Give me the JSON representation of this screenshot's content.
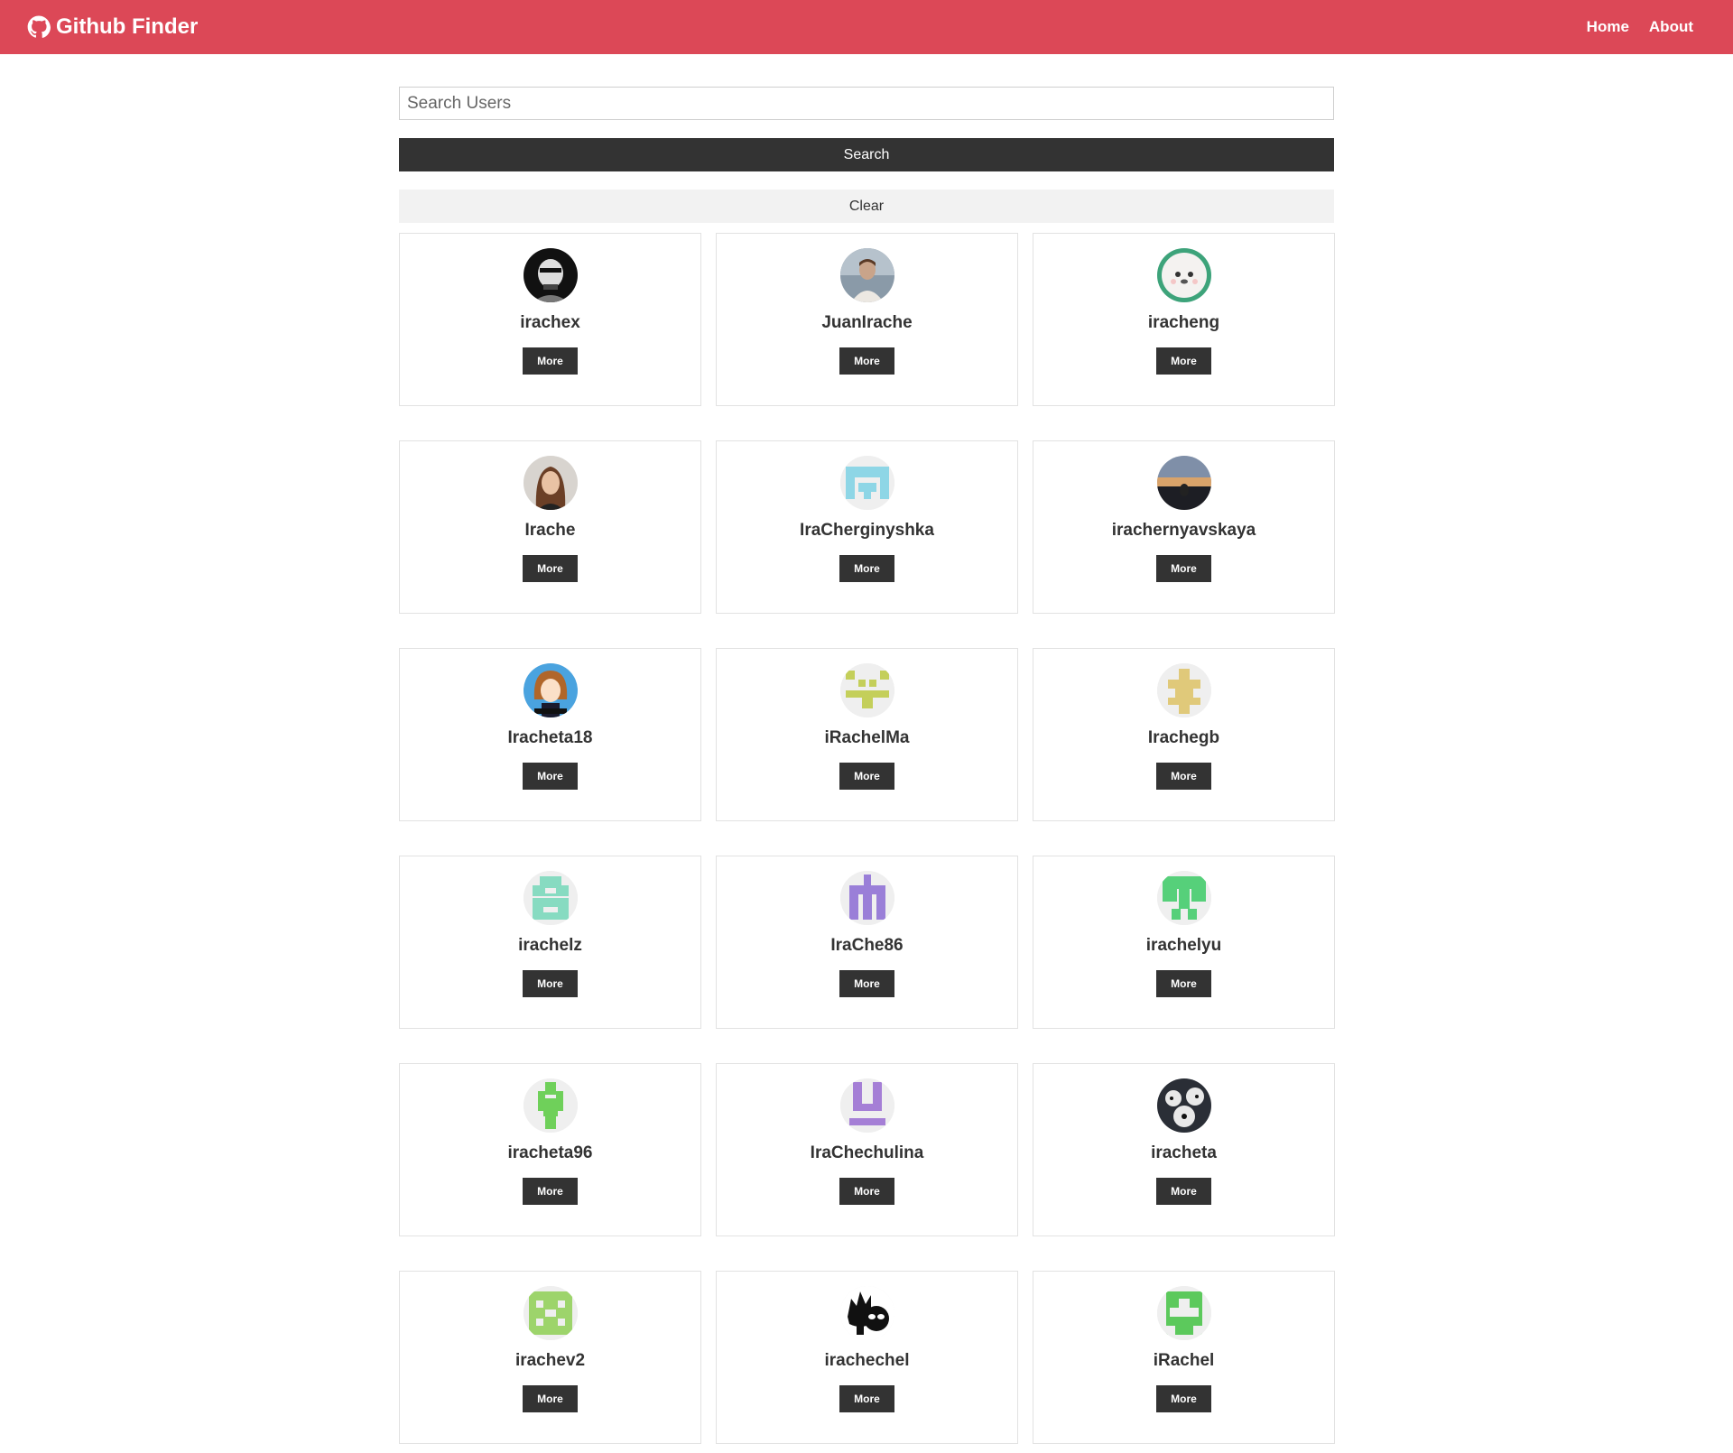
{
  "navbar": {
    "title": "Github Finder",
    "links": [
      {
        "label": "Home"
      },
      {
        "label": "About"
      }
    ]
  },
  "search": {
    "placeholder": "Search Users",
    "value": "",
    "submit_label": "Search",
    "clear_label": "Clear"
  },
  "users": [
    {
      "login": "irachex",
      "button": "More",
      "avatar": "photo-bw"
    },
    {
      "login": "JuanIrache",
      "button": "More",
      "avatar": "photo-man"
    },
    {
      "login": "iracheng",
      "button": "More",
      "avatar": "cartoon-face"
    },
    {
      "login": "Irache",
      "button": "More",
      "avatar": "photo-woman"
    },
    {
      "login": "IraCherginyshka",
      "button": "More",
      "avatar": "identicon-lightblue"
    },
    {
      "login": "irachernyavskaya",
      "button": "More",
      "avatar": "photo-sunset"
    },
    {
      "login": "Iracheta18",
      "button": "More",
      "avatar": "anime"
    },
    {
      "login": "iRachelMa",
      "button": "More",
      "avatar": "identicon-olive"
    },
    {
      "login": "Irachegb",
      "button": "More",
      "avatar": "identicon-gold"
    },
    {
      "login": "irachelz",
      "button": "More",
      "avatar": "identicon-mint"
    },
    {
      "login": "IraChe86",
      "button": "More",
      "avatar": "identicon-purple"
    },
    {
      "login": "irachelyu",
      "button": "More",
      "avatar": "identicon-green"
    },
    {
      "login": "iracheta96",
      "button": "More",
      "avatar": "identicon-lime"
    },
    {
      "login": "IraChechulina",
      "button": "More",
      "avatar": "identicon-lavender"
    },
    {
      "login": "iracheta",
      "button": "More",
      "avatar": "photo-dark"
    },
    {
      "login": "irachev2",
      "button": "More",
      "avatar": "identicon-yellowgreen"
    },
    {
      "login": "irachechel",
      "button": "More",
      "avatar": "cartoon-rickmorty"
    },
    {
      "login": "iRachel",
      "button": "More",
      "avatar": "identicon-brightgreen"
    }
  ]
}
